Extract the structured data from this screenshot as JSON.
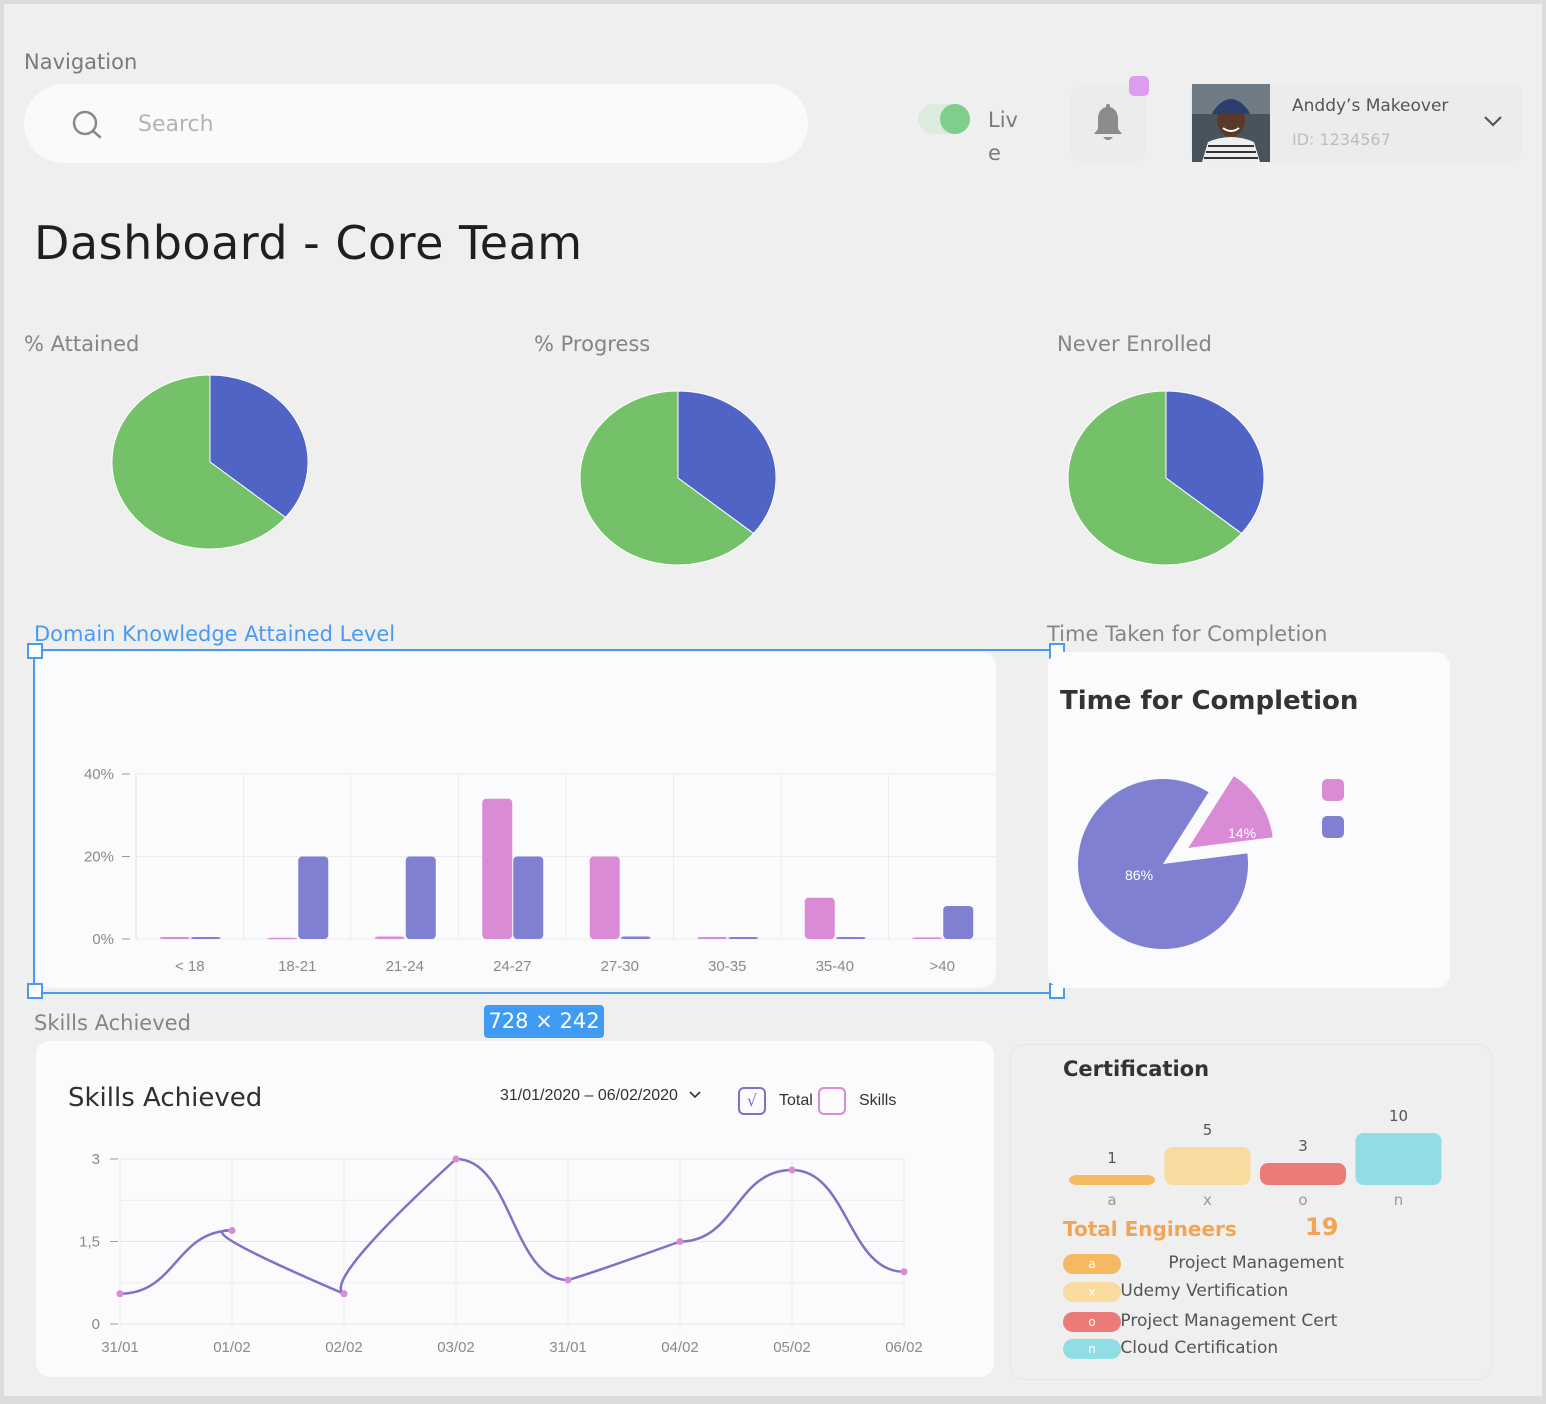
{
  "navigation": {
    "label": "Navigation",
    "search_placeholder": "Search",
    "live_label": "Live",
    "user": {
      "name": "Anddy’s Makeover",
      "id": "ID: 1234567"
    }
  },
  "page_title": "Dashboard - Core Team",
  "pies": [
    {
      "label": "% Attained"
    },
    {
      "label": "% Progress"
    },
    {
      "label": "Never Enrolled"
    }
  ],
  "domain": {
    "section_label": "Domain Knowledge Attained Level"
  },
  "time": {
    "section_label": "Time Taken for Completion",
    "card_title": "Time for Completion"
  },
  "skills": {
    "section_label": "Skills Achieved",
    "card_title": "Skills Achieved",
    "date_range": "31/01/2020 – 06/02/2020",
    "check_total": "Total",
    "check_total_mark": "√",
    "check_skills": "Skills"
  },
  "selection_badge": "728 × 242",
  "certification": {
    "title": "Certification",
    "total_label": "Total Engineers",
    "total_value": "19",
    "legend": [
      {
        "key": "a",
        "label": "Project Management",
        "color": "#f4b961"
      },
      {
        "key": "x",
        "label": "Udemy Vertification",
        "color": "#f9dba0"
      },
      {
        "key": "o",
        "label": "Project Management Cert",
        "color": "#ec7a76"
      },
      {
        "key": "n",
        "label": "Cloud Certification",
        "color": "#90dde3"
      }
    ]
  },
  "chart_data": [
    {
      "type": "pie",
      "title": "% Attained",
      "slices": [
        {
          "value": 36,
          "color": "#5064c6"
        },
        {
          "value": 64,
          "color": "#74c169"
        }
      ]
    },
    {
      "type": "pie",
      "title": "% Progress",
      "slices": [
        {
          "value": 36,
          "color": "#5064c6"
        },
        {
          "value": 64,
          "color": "#74c169"
        }
      ]
    },
    {
      "type": "pie",
      "title": "Never Enrolled",
      "slices": [
        {
          "value": 36,
          "color": "#5064c6"
        },
        {
          "value": 64,
          "color": "#74c169"
        }
      ]
    },
    {
      "type": "bar",
      "title": "Domain Knowledge Attained Level",
      "categories": [
        "< 18",
        "18-21",
        "21-24",
        "24-27",
        "27-30",
        "30-35",
        "35-40",
        ">40"
      ],
      "yticks": [
        "0%",
        "20%",
        "40%"
      ],
      "ylim": [
        0,
        40
      ],
      "series": [
        {
          "color": "#d98bd6",
          "values": [
            0.5,
            0.3,
            0.6,
            34,
            20,
            0.5,
            10,
            0.4
          ]
        },
        {
          "color": "#8080d2",
          "values": [
            0.5,
            20,
            20,
            20,
            0.6,
            0.5,
            0.5,
            8
          ]
        }
      ]
    },
    {
      "type": "pie",
      "title": "Time for Completion",
      "slices": [
        {
          "value": 86,
          "label": "86%",
          "color": "#8080d2"
        },
        {
          "value": 14,
          "label": "14%",
          "color": "#d98bd6"
        }
      ]
    },
    {
      "type": "line",
      "title": "Skills Achieved",
      "x": [
        "31/01",
        "01/02",
        "02/02",
        "03/02",
        "31/01",
        "04/02",
        "05/02",
        "06/02"
      ],
      "yticks": [
        "0",
        "1,5",
        "3"
      ],
      "ylim": [
        0,
        3
      ],
      "series": [
        {
          "color": "#7d73c6",
          "values": [
            0.55,
            1.25,
            0.5,
            3.0,
            0.5,
            1.1,
            2.8,
            0.95
          ],
          "marked_points": [
            [
              0,
              0.55
            ],
            [
              1,
              1.7
            ],
            [
              2,
              0.55
            ],
            [
              3,
              3.0
            ],
            [
              4,
              0.8
            ],
            [
              5,
              1.5
            ],
            [
              6,
              2.8
            ],
            [
              7,
              0.95
            ]
          ]
        }
      ]
    },
    {
      "type": "bar",
      "title": "Certification",
      "categories": [
        "a",
        "x",
        "o",
        "n"
      ],
      "values": [
        1,
        5,
        3,
        10
      ],
      "colors": [
        "#f4b961",
        "#f9dba0",
        "#ec7a76",
        "#90dde3"
      ]
    }
  ]
}
